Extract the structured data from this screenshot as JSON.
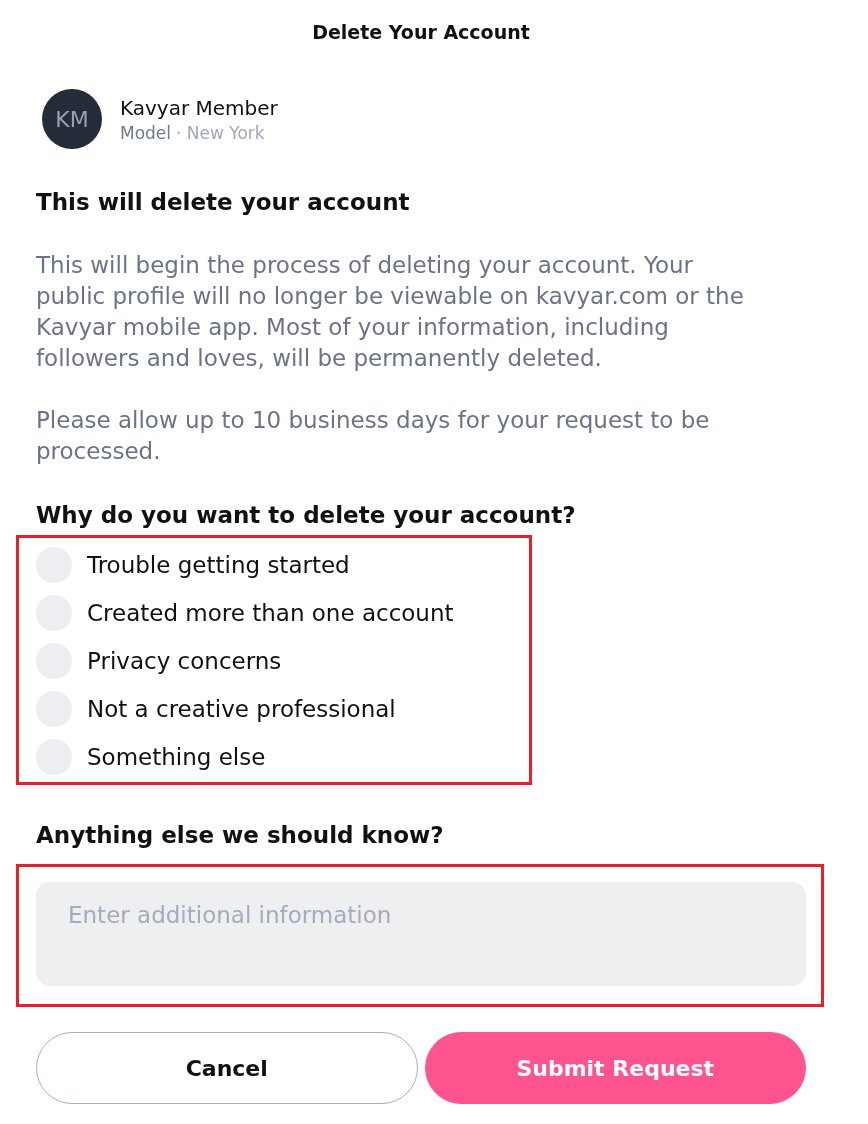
{
  "title": "Delete Your Account",
  "profile": {
    "initials": "KM",
    "name": "Kavyar Member",
    "role": "Model",
    "location": "· New York"
  },
  "intro": {
    "heading": "This will delete your account",
    "paragraphs": [
      "This will begin the process of deleting your account. Your public profile will no longer be viewable on kavyar.com or the Kavyar mobile app. Most of your information, including followers and loves, will be permanently deleted.",
      "Please allow up to 10 business days for your request to be processed."
    ]
  },
  "reasons": {
    "heading": "Why do you want to delete your account?",
    "highlighted": true,
    "options": [
      {
        "label": "Trouble getting started",
        "selected": false
      },
      {
        "label": "Created more than one account",
        "selected": false
      },
      {
        "label": "Privacy concerns",
        "selected": false
      },
      {
        "label": "Not a creative professional",
        "selected": false
      },
      {
        "label": "Something else",
        "selected": false
      }
    ]
  },
  "details": {
    "heading": "Anything else we should know?",
    "highlighted": true,
    "placeholder": "Enter additional information"
  },
  "buttons": [
    {
      "label": "Cancel",
      "kind": "secondary"
    },
    {
      "label": "Submit Request",
      "kind": "primary"
    }
  ]
}
